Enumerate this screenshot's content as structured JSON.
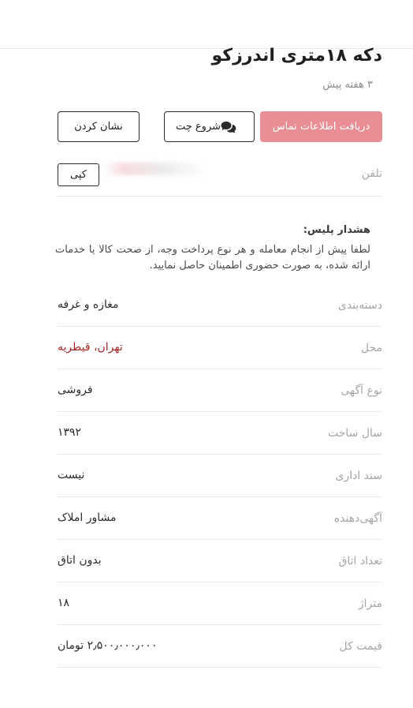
{
  "header": {
    "title": "دکه ۱۸متری اندرزکو",
    "time_ago": "۳ هفته پیش"
  },
  "actions": {
    "contact_label": "دریافت اطلاعات تماس",
    "chat_label": "شروع چت",
    "mark_label": "نشان کردن",
    "contact_color": "#e88e94"
  },
  "phone": {
    "label": "تلفن",
    "copy_label": "کپی"
  },
  "warning": {
    "title": "هشدار پلیس:",
    "body": "لطفا پیش از انجام معامله و هر نوع پرداخت وجه، از صحت کالا یا خدمات ارائه شده، به صورت حضوری اطمینان حاصل نمایید."
  },
  "details": [
    {
      "label": "دسته‌بندی",
      "value": "مغازه و غرفه"
    },
    {
      "label": "محل",
      "value": "تهران، قیطریه"
    },
    {
      "label": "نوع آگهی",
      "value": "فروشی"
    },
    {
      "label": "سال ساخت",
      "value": "۱۳۹۲"
    },
    {
      "label": "سند اداری",
      "value": "نیست"
    },
    {
      "label": "آگهی‌دهنده",
      "value": "مشاور املاک"
    },
    {
      "label": "تعداد اتاق",
      "value": "بدون اتاق"
    },
    {
      "label": "متراژ",
      "value": "۱۸"
    },
    {
      "label": "قیمت کل",
      "value": "۲٫۵۰۰٫۰۰۰٫۰۰۰ تومان"
    }
  ],
  "icons": {
    "chat": "chat-bubbles-icon"
  },
  "colors": {
    "location_link": "#a62626"
  }
}
